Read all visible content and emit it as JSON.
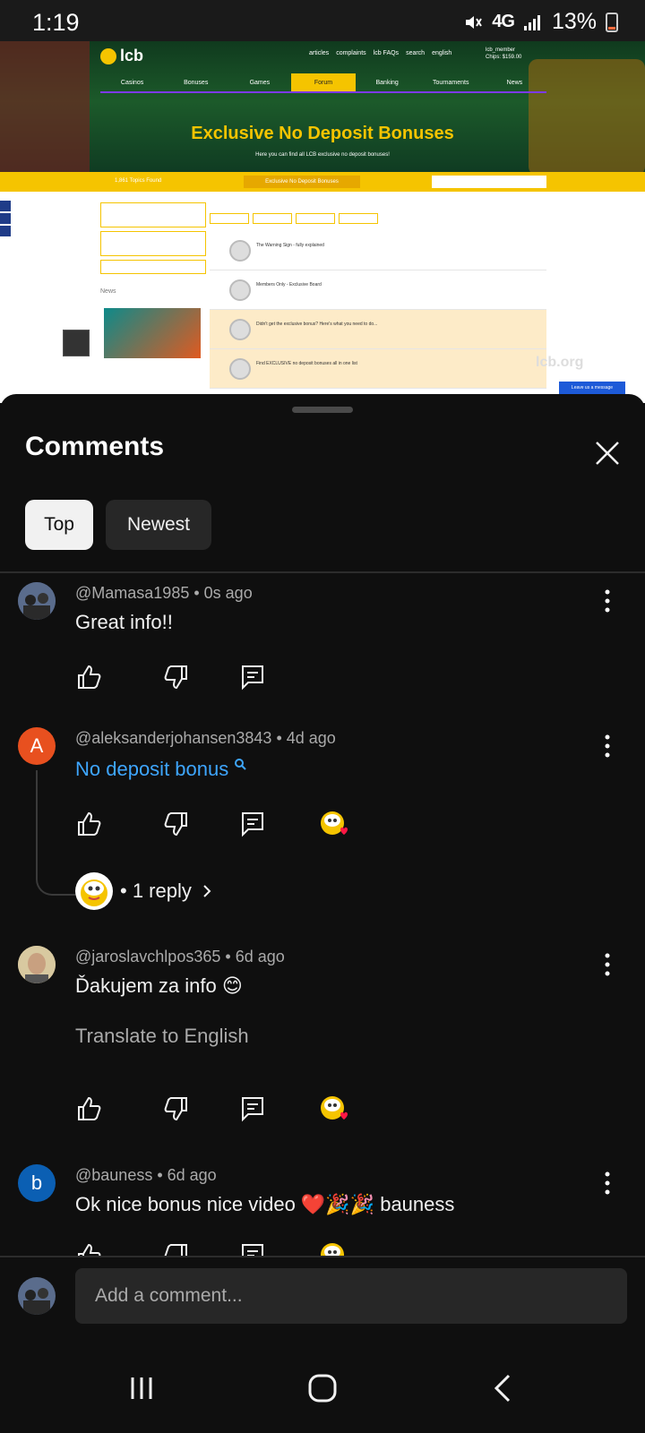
{
  "status_bar": {
    "time": "1:19",
    "network": "4G",
    "battery": "13%"
  },
  "video": {
    "site_logo": "lcb",
    "nav": [
      "Casinos",
      "Bonuses",
      "Games",
      "Forum",
      "Banking",
      "Tournaments",
      "News"
    ],
    "top_links": [
      "articles",
      "complaints",
      "lcb FAQs",
      "search",
      "english"
    ],
    "user": "lcb_member",
    "chips": "Chips: $159.00",
    "hero_title": "Exclusive No Deposit Bonuses",
    "hero_subtitle": "Here you can find all LCB exclusive no deposit bonuses!",
    "topics_found": "1,861 Topics Found",
    "breadcrumb": "Exclusive No Deposit Bonuses",
    "news_label": "News",
    "rows": [
      "The Warning Sign - fully explained",
      "Members Only - Exclusive Board",
      "Didn't get the exclusive bonus? Here's what you need to do...",
      "Find EXCLUSIVE no deposit bonuses all in one list"
    ],
    "watermark": "lcb.org",
    "chat_button": "Leave us a message"
  },
  "sheet": {
    "title": "Comments",
    "filters": [
      "Top",
      "Newest"
    ],
    "active_filter": "Top"
  },
  "comments": [
    {
      "author": "@Mamasa1985",
      "time": "0s ago",
      "text": "Great info!!",
      "avatar_color": "#3b4a6b"
    },
    {
      "author": "@aleksanderjohansen3843",
      "time": "4d ago",
      "text": "No deposit bonus",
      "avatar_letter": "A",
      "avatar_color": "#e8501f",
      "reply_count": "1 reply"
    },
    {
      "author": "@jaroslavchlpos365",
      "time": "6d ago",
      "text": "Ďakujem za info 😊",
      "translate": "Translate to English",
      "avatar_color": "#c9b88a"
    },
    {
      "author": "@bauness",
      "time": "6d ago",
      "text": "Ok nice bonus nice video ❤️🎉🎉 bauness",
      "avatar_letter": "b",
      "avatar_color": "#0b5fb3"
    }
  ],
  "composer": {
    "placeholder": "Add a comment..."
  },
  "colors": {
    "accent_link": "#3ea6ff",
    "background": "#0f0f0f",
    "lcb_yellow": "#f5c400"
  }
}
